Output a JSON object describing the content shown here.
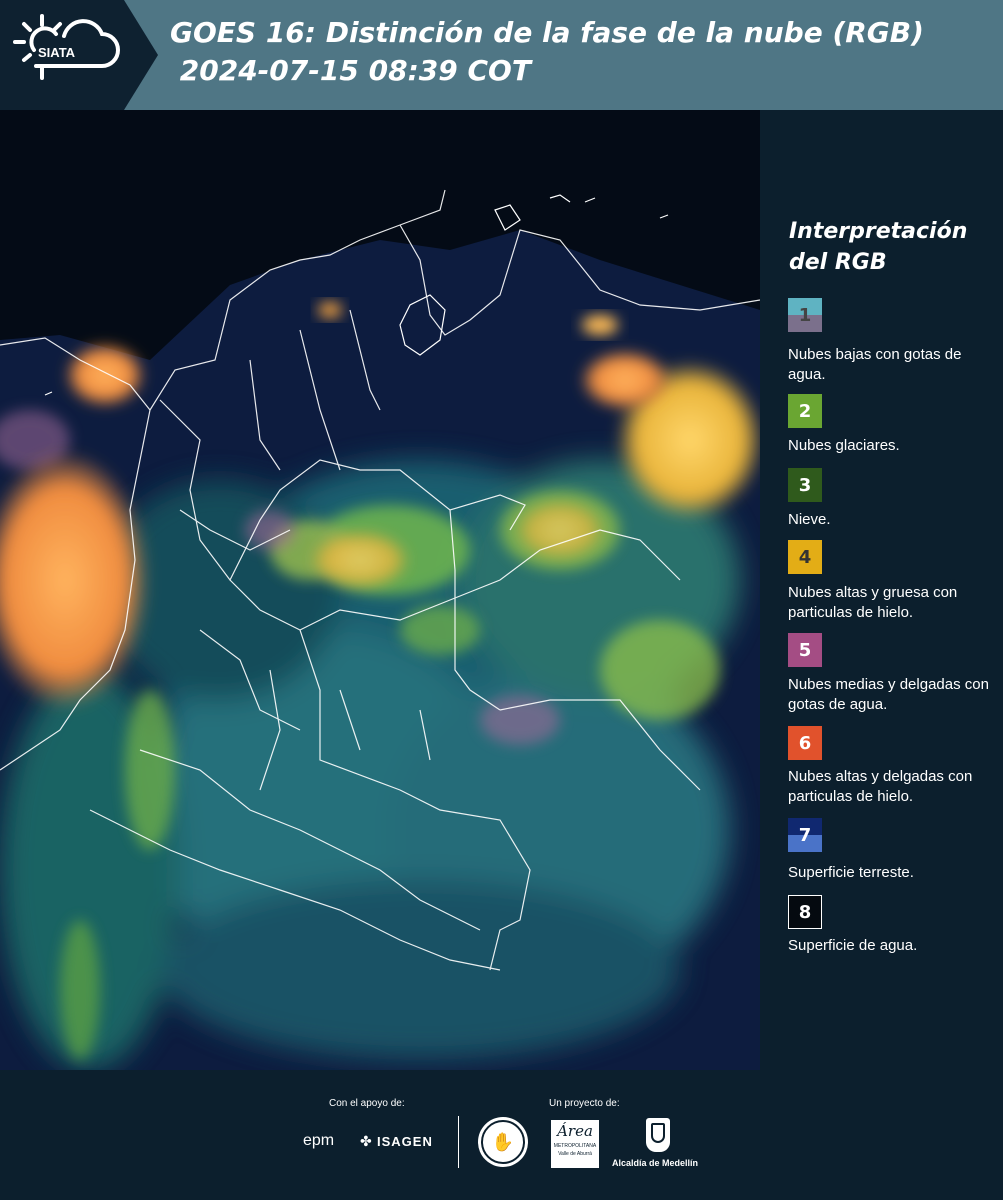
{
  "header": {
    "logo_text": "SIATA",
    "title": "GOES 16: Distinción de la fase de la nube (RGB)\n 2024-07-15 08:39 COT"
  },
  "legend": {
    "title": "Interpretación del RGB",
    "items": [
      {
        "number": "1",
        "label": "Nubes bajas con gotas de agua.",
        "color_top": "#5fb3c2",
        "color_bottom": "#7b708c",
        "text_color": "#444444"
      },
      {
        "number": "2",
        "label": "Nubes glaciares.",
        "color": "#6aa632",
        "text_color": "#ffffff"
      },
      {
        "number": "3",
        "label": "Nieve.",
        "color": "#2f5a1c",
        "text_color": "#ffffff"
      },
      {
        "number": "4",
        "label": "Nubes altas y gruesa con particulas de hielo.",
        "color": "#e3ad16",
        "text_color": "#333333"
      },
      {
        "number": "5",
        "label": "Nubes medias y delgadas con gotas de agua.",
        "color": "#a44d84",
        "text_color": "#ffffff"
      },
      {
        "number": "6",
        "label": "Nubes altas y delgadas con particulas de hielo.",
        "color": "#e1522c",
        "text_color": "#ffffff"
      },
      {
        "number": "7",
        "label": "Superficie terreste.",
        "color_top": "#102870",
        "color_bottom": "#4a73c8",
        "text_color": "#ffffff"
      },
      {
        "number": "8",
        "label": "Superficie de agua.",
        "color": "#050a10",
        "text_color": "#ffffff"
      }
    ]
  },
  "footer": {
    "support_label": "Con el apoyo de:",
    "project_label": "Un proyecto de:",
    "sponsor1": "epm",
    "sponsor2": "ISAGEN",
    "partner_amva_name": "Área",
    "partner_amva_sub1": "METROPOLITANA",
    "partner_amva_sub2": "Valle de Aburrá",
    "partner_medellin": "Alcaldía de Medellín"
  },
  "colors": {
    "header_bg": "#4f7685",
    "logo_bg": "#0e2130",
    "page_bg": "#0c1f2d",
    "map_bg": "#040a14"
  }
}
